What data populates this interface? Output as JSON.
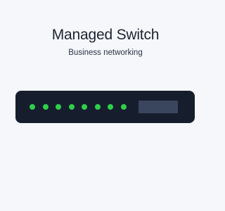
{
  "header": {
    "title": "Managed Switch",
    "subtitle": "Business networking"
  },
  "device": {
    "name": "switch",
    "port_led_count": 8,
    "led_color": "#2fcf4a",
    "panel_color": "#3a465e",
    "body_color": "#161d2d"
  }
}
